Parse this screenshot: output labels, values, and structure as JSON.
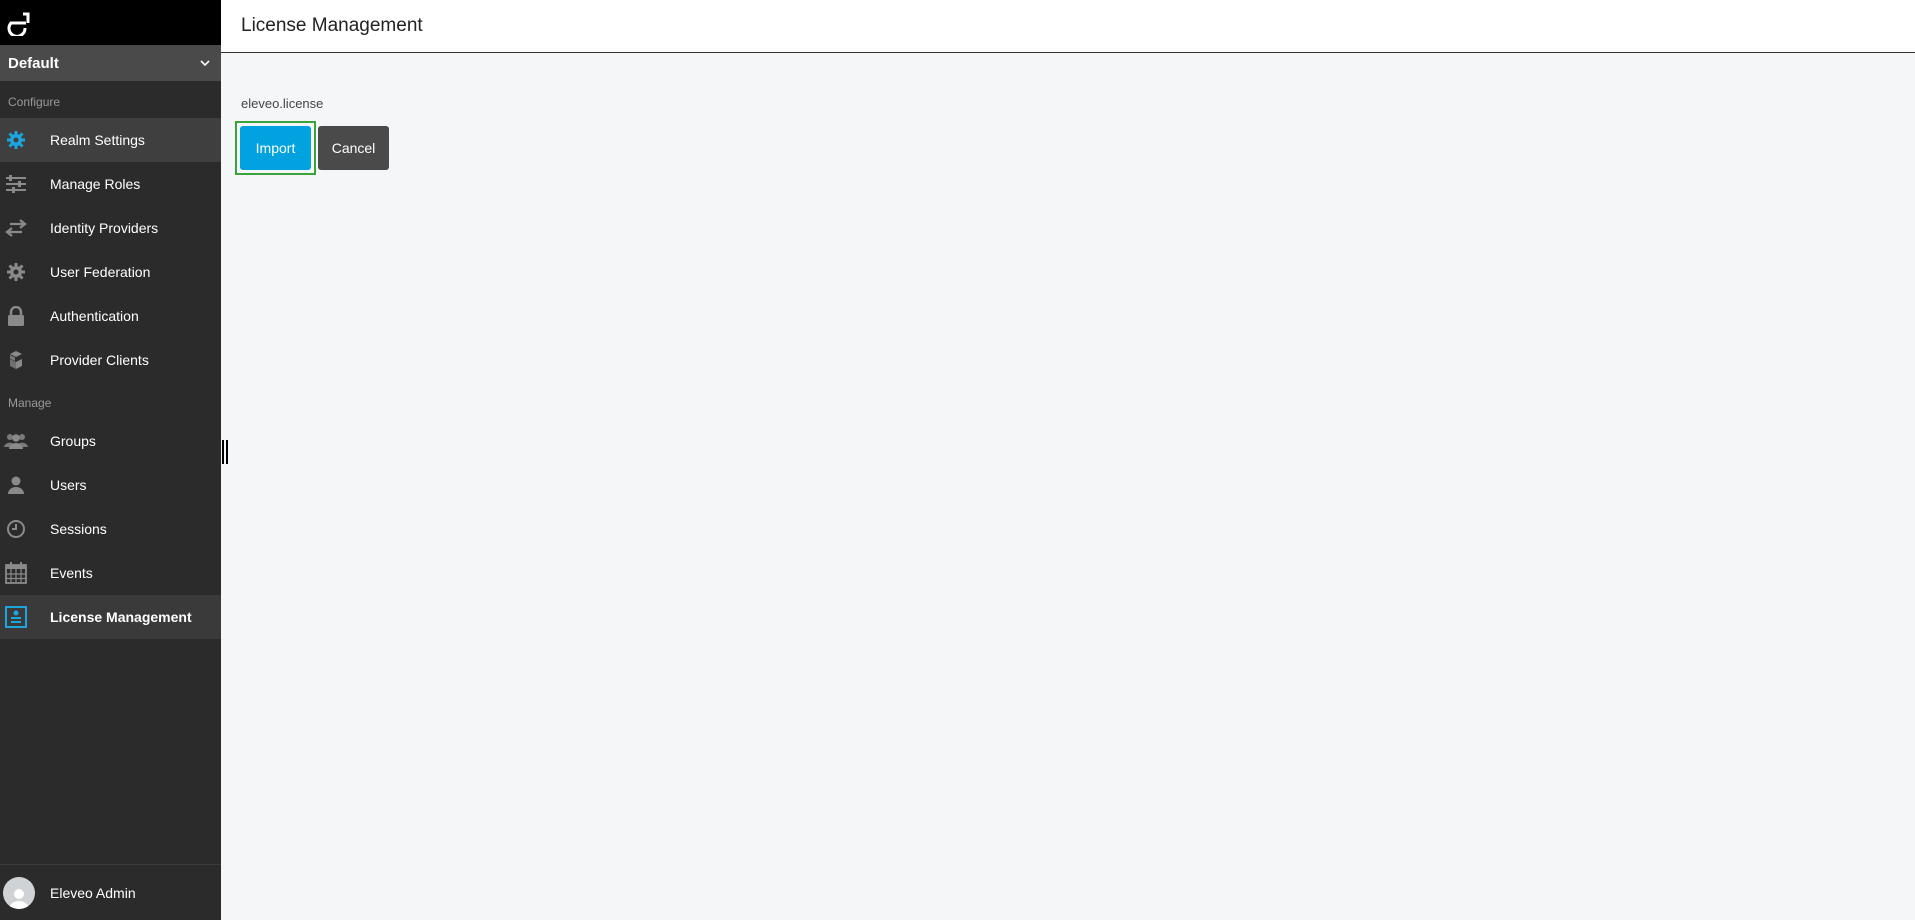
{
  "sidebar": {
    "logo_icon": "eleveo-logo",
    "realm_selector": {
      "value": "Default",
      "icon": "chevron-down-icon"
    },
    "sections": {
      "configure": "Configure",
      "manage": "Manage"
    },
    "configure_items": [
      {
        "label": "Realm Settings",
        "icon": "gear-icon"
      },
      {
        "label": "Manage Roles",
        "icon": "sliders-icon"
      },
      {
        "label": "Identity Providers",
        "icon": "exchange-icon"
      },
      {
        "label": "User Federation",
        "icon": "gear-icon"
      },
      {
        "label": "Authentication",
        "icon": "lock-icon"
      },
      {
        "label": "Provider Clients",
        "icon": "cubes-icon"
      }
    ],
    "manage_items": [
      {
        "label": "Groups",
        "icon": "users-icon"
      },
      {
        "label": "Users",
        "icon": "user-icon"
      },
      {
        "label": "Sessions",
        "icon": "clock-icon"
      },
      {
        "label": "Events",
        "icon": "calendar-icon"
      },
      {
        "label": "License Management",
        "icon": "license-icon"
      }
    ],
    "user": {
      "name": "Eleveo Admin",
      "icon": "avatar"
    }
  },
  "header": {
    "title": "License Management"
  },
  "content": {
    "filename": "eleveo.license",
    "import_label": "Import",
    "cancel_label": "Cancel"
  },
  "colors": {
    "accent": "#00a3e0",
    "sidebar_bg": "#2b2b2b",
    "highlight_border": "#3aa33a"
  }
}
